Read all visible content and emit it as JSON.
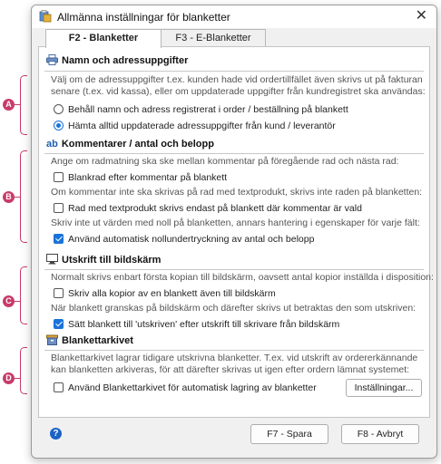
{
  "window": {
    "title": "Allmänna inställningar för blanketter",
    "close_glyph": "✕"
  },
  "tabs": [
    {
      "label": "F2 - Blanketter",
      "active": true
    },
    {
      "label": "F3 - E-Blanketter",
      "active": false
    }
  ],
  "sections": {
    "name_address": {
      "heading": "Namn och adressuppgifter",
      "icon": "printer-icon",
      "desc1": "Välj om de adressuppgifter t.ex. kunden hade vid ordertillfället även skrivs ut på fakturan",
      "desc2": "senare (t.ex. vid kassa), eller om uppdaterade uppgifter från kundregistret ska användas:",
      "option1": "Behåll namn och adress registrerat i order / beställning på blankett",
      "option2": "Hämta alltid uppdaterade adressuppgifter från kund / leverantör",
      "selected": 2
    },
    "comments": {
      "heading": "Kommentarer / antal och belopp",
      "icon_text": "ab",
      "desc1": "Ange om radmatning ska ske mellan kommentar på föregående rad och nästa rad:",
      "option1": "Blankrad efter kommentar på blankett",
      "desc2": "Om kommentar inte ska skrivas på rad med textprodukt, skrivs inte raden på blanketten:",
      "option2": "Rad med textprodukt skrivs endast på blankett där kommentar är vald",
      "desc3": "Skriv inte ut värden med noll på blanketten, annars hantering i egenskaper för varje fält:",
      "option3": "Använd automatisk nollundertryckning av antal och belopp",
      "checked": [
        false,
        false,
        true
      ]
    },
    "screen_output": {
      "heading": "Utskrift till bildskärm",
      "icon": "monitor-icon",
      "desc1": "Normalt skrivs enbart första kopian till bildskärm, oavsett antal kopior inställda i disposition:",
      "option1": "Skriv alla kopior av en blankett även till bildskärm",
      "desc2": "När blankett granskas på bildskärm och därefter skrivs ut betraktas den som utskriven:",
      "option2": "Sätt blankett till 'utskriven' efter utskrift till skrivare från bildskärm",
      "checked": [
        false,
        true
      ]
    },
    "archive": {
      "heading": "Blankettarkivet",
      "icon": "archive-icon",
      "desc1": "Blankettarkivet lagrar tidigare utskrivna blanketter. T.ex. vid utskrift av orderer­kännande",
      "desc2": "kan blanketten arkiveras, för att därefter skrivas ut igen efter ordern lämnat systemet:",
      "option1": "Använd Blankettarkivet för automatisk lagring av blanketter",
      "settings_button": "Inställningar...",
      "checked": [
        false
      ]
    }
  },
  "footer": {
    "help_glyph": "?",
    "save_button": "F7 - Spara",
    "cancel_button": "F8 - Avbryt"
  },
  "callouts": [
    "A",
    "B",
    "C",
    "D"
  ],
  "colors": {
    "accent": "#1a73d9",
    "callout": "#c83b6a"
  }
}
